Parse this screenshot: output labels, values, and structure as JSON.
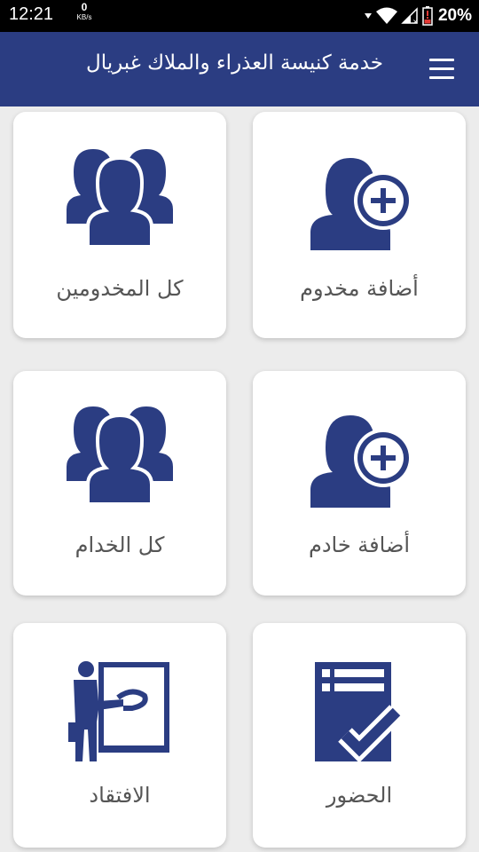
{
  "status_bar": {
    "time": "12:21",
    "net_speed_value": "0",
    "net_speed_unit": "KB/s",
    "battery_percent": "20%"
  },
  "app_bar": {
    "title": "خدمة كنيسة العذراء والملاك غبريال",
    "menu_icon": "hamburger-menu-icon"
  },
  "colors": {
    "primary": "#2b3d82",
    "card_background": "#ffffff",
    "page_background": "#ececec",
    "label_text": "#555555",
    "battery_alert": "#e53935"
  },
  "cards": [
    {
      "label": "أضافة مخدوم",
      "icon": "add-user-icon"
    },
    {
      "label": "كل المخدومين",
      "icon": "group-icon"
    },
    {
      "label": "أضافة خادم",
      "icon": "add-user-icon"
    },
    {
      "label": "كل الخدام",
      "icon": "group-icon"
    },
    {
      "label": "الحضور",
      "icon": "attendance-checklist-icon"
    },
    {
      "label": "الافتقاد",
      "icon": "presenter-board-icon"
    }
  ]
}
